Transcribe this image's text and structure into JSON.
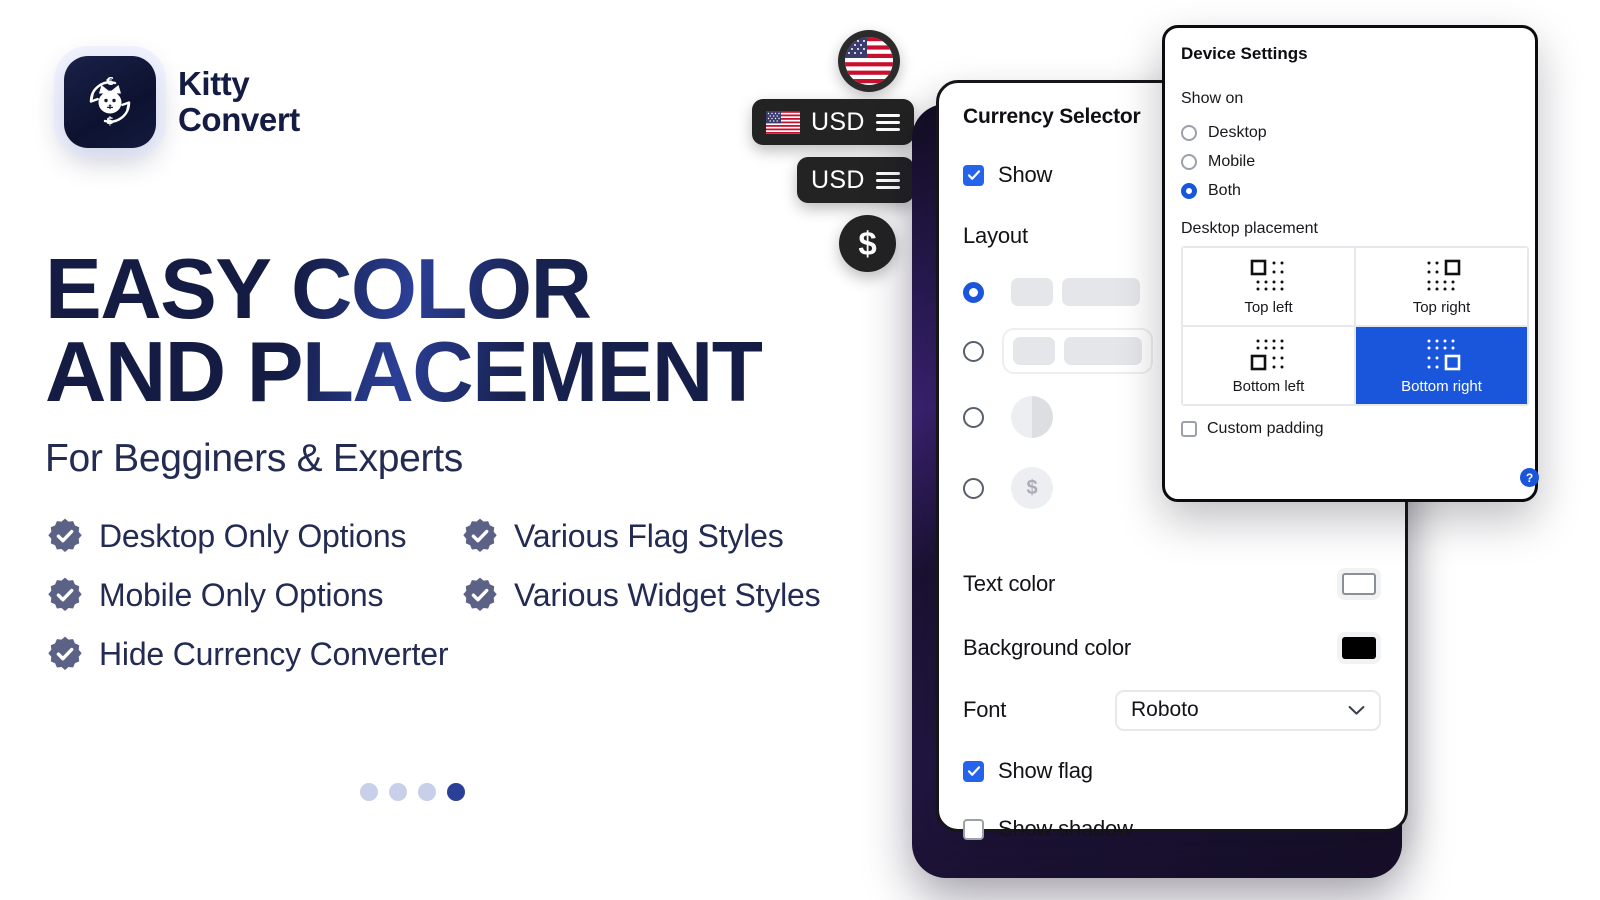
{
  "brand": {
    "name_line1": "Kitty",
    "name_line2": "Convert",
    "logo_icon": "kitty-currency-logo"
  },
  "hero": {
    "headline": "EASY COLOR\nAND PLACEMENT",
    "subhead": "For Begginers & Experts",
    "features": [
      [
        "Desktop Only Options",
        "Various Flag Styles"
      ],
      [
        "Mobile Only Options",
        "Various Widget Styles"
      ],
      [
        "Hide Currency Converter"
      ]
    ]
  },
  "widget_previews": {
    "flag_circle": {
      "icon": "us-flag-circle"
    },
    "flag_bar": {
      "label": "USD",
      "icon": "us-flag",
      "menu_icon": "hamburger-menu-icon"
    },
    "text_bar": {
      "label": "USD",
      "menu_icon": "hamburger-menu-icon"
    },
    "dollar_circle": {
      "label": "$"
    }
  },
  "panel_main": {
    "title": "Currency Selector",
    "show": {
      "label": "Show",
      "checked": true
    },
    "layout": {
      "label": "Layout",
      "options": [
        {
          "id": "flag-and-text",
          "selected": true,
          "preview": "pill-pair-plain"
        },
        {
          "id": "boxed-pair",
          "selected": false,
          "preview": "pill-pair-boxed"
        },
        {
          "id": "circle-flag",
          "selected": false,
          "preview": "circle-half"
        },
        {
          "id": "circle-symbol",
          "selected": false,
          "preview": "circle-dollar",
          "symbol": "$"
        }
      ]
    },
    "text_color": {
      "label": "Text color",
      "value": "#ffffff"
    },
    "background_color": {
      "label": "Background color",
      "value": "#000000"
    },
    "font": {
      "label": "Font",
      "value": "Roboto",
      "chevron_icon": "chevron-down-icon"
    },
    "show_flag": {
      "label": "Show flag",
      "checked": true
    },
    "show_shadow": {
      "label": "Show shadow",
      "checked": false
    }
  },
  "panel_device": {
    "title": "Device Settings",
    "show_on": {
      "label": "Show on",
      "options": [
        {
          "label": "Desktop",
          "selected": false
        },
        {
          "label": "Mobile",
          "selected": false
        },
        {
          "label": "Both",
          "selected": true
        }
      ]
    },
    "desktop_placement": {
      "label": "Desktop placement",
      "options": [
        {
          "label": "Top left",
          "corner": "tl",
          "selected": false
        },
        {
          "label": "Top right",
          "corner": "tr",
          "selected": false
        },
        {
          "label": "Bottom left",
          "corner": "bl",
          "selected": false
        },
        {
          "label": "Bottom right",
          "corner": "br",
          "selected": true
        }
      ]
    },
    "custom_padding": {
      "label": "Custom padding",
      "checked": false
    },
    "help": {
      "label": "?",
      "icon": "help-icon"
    }
  },
  "pagination": {
    "count": 4,
    "active_index": 3
  },
  "colors": {
    "brand_navy": "#141c44",
    "accent_blue": "#1a56db",
    "check_blue": "#2563eb",
    "badge_slate": "#5b6286",
    "gradient_magenta": "#c50fbe",
    "dot_inactive": "#c8cfe8",
    "dot_active": "#2b3f96"
  }
}
